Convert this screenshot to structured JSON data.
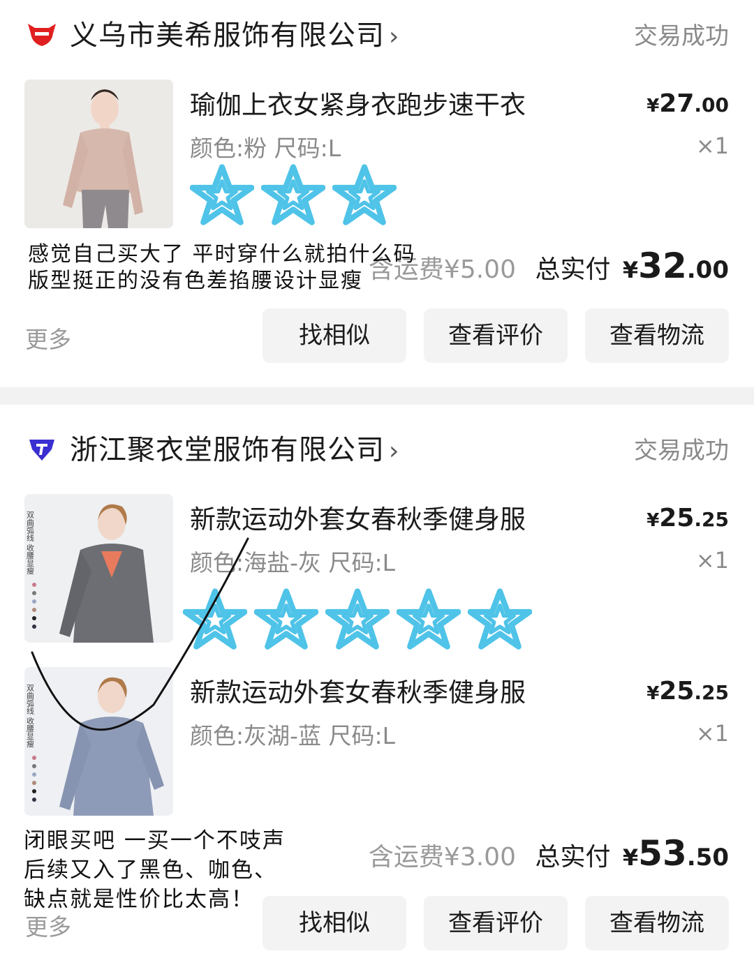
{
  "orders": [
    {
      "shop_name": "义乌市美希服饰有限公司",
      "status": "交易成功",
      "items": [
        {
          "title": "瑜伽上衣女紧身衣跑步速干衣",
          "spec": "颜色:粉 尺码:L",
          "price_currency": "¥",
          "price_int": "27",
          "price_dec": ".00",
          "qty": "×1"
        }
      ],
      "shipping": "含运费¥5.00",
      "total_label": "总实付",
      "total_currency": "¥",
      "total_int": "32",
      "total_dec": ".00",
      "more": "更多",
      "buttons": [
        "找相似",
        "查看评价",
        "查看物流"
      ],
      "rating_stars": 3,
      "comment_lines": [
        "感觉自己买大了 平时穿什么就拍什么码",
        "版型挺正的没有色差掐腰设计显瘦"
      ]
    },
    {
      "shop_name": "浙江聚衣堂服饰有限公司",
      "status": "交易成功",
      "items": [
        {
          "title": "新款运动外套女春秋季健身服",
          "spec": "颜色:海盐-灰 尺码:L",
          "price_currency": "¥",
          "price_int": "25",
          "price_dec": ".25",
          "qty": "×1"
        },
        {
          "title": "新款运动外套女春秋季健身服",
          "spec": "颜色:灰湖-蓝 尺码:L",
          "price_currency": "¥",
          "price_int": "25",
          "price_dec": ".25",
          "qty": "×1"
        }
      ],
      "shipping": "含运费¥3.00",
      "total_label": "总实付",
      "total_currency": "¥",
      "total_int": "53",
      "total_dec": ".50",
      "more": "更多",
      "buttons": [
        "找相似",
        "查看评价",
        "查看物流"
      ],
      "rating_stars": 5,
      "comment_lines": [
        "闭眼买吧 一买一个不吱声",
        "后续又入了黑色、咖色、",
        "缺点就是性价比太高！"
      ]
    }
  ],
  "thumb_vertical_text": "双曲弧线 收腰显瘦",
  "colors": {
    "star": "#4fc3e8",
    "shop1_logo": "#e02020",
    "shop2_logo": "#3a2fd0",
    "muted": "#8a8a8a",
    "button_bg": "#f3f3f3"
  },
  "icons": [
    "tmall-cat-icon",
    "shop-badge-icon",
    "star-icon",
    "chevron-right-icon"
  ]
}
